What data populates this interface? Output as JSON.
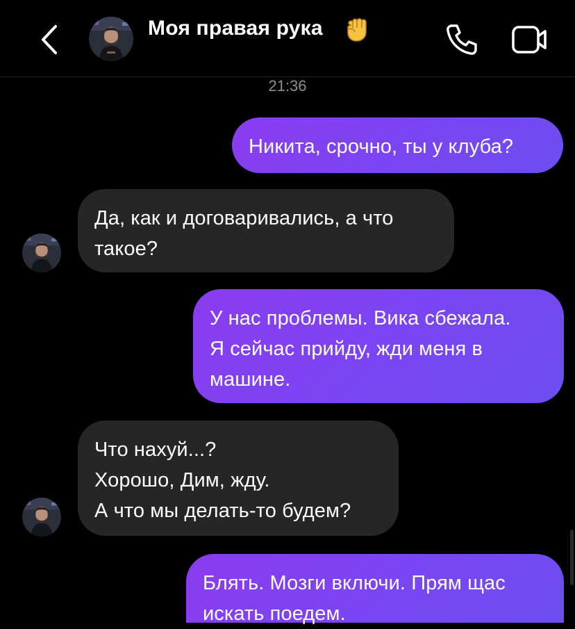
{
  "header": {
    "contact_name": "Моя правая рука",
    "back_icon": "chevron-left-icon",
    "fist_emoji_icon": "raised-fist-emoji",
    "call_icon": "phone-icon",
    "video_icon": "video-camera-icon"
  },
  "chat": {
    "timestamp": "21:36",
    "messages": [
      {
        "direction": "outgoing",
        "text": "Никита, срочно, ты у клуба?"
      },
      {
        "direction": "incoming",
        "text": "Да, как и договаривались, а что\nтакое?"
      },
      {
        "direction": "outgoing",
        "text": "У нас проблемы. Вика сбежала.\nЯ сейчас прийду, жди меня в\nмашине."
      },
      {
        "direction": "incoming",
        "text": "Что нахуй...?\nХорошо, Дим, жду.\nА что мы делать-то будем?"
      },
      {
        "direction": "outgoing",
        "text": "Блять. Мозги включи. Прям щас\nискать поедем."
      }
    ]
  },
  "colors": {
    "background": "#000000",
    "outgoing_bubble_start": "#8a3cf0",
    "outgoing_bubble_end": "#6c4ff0",
    "incoming_bubble": "#262626",
    "timestamp_text": "#8e8e93",
    "text": "#ffffff"
  }
}
